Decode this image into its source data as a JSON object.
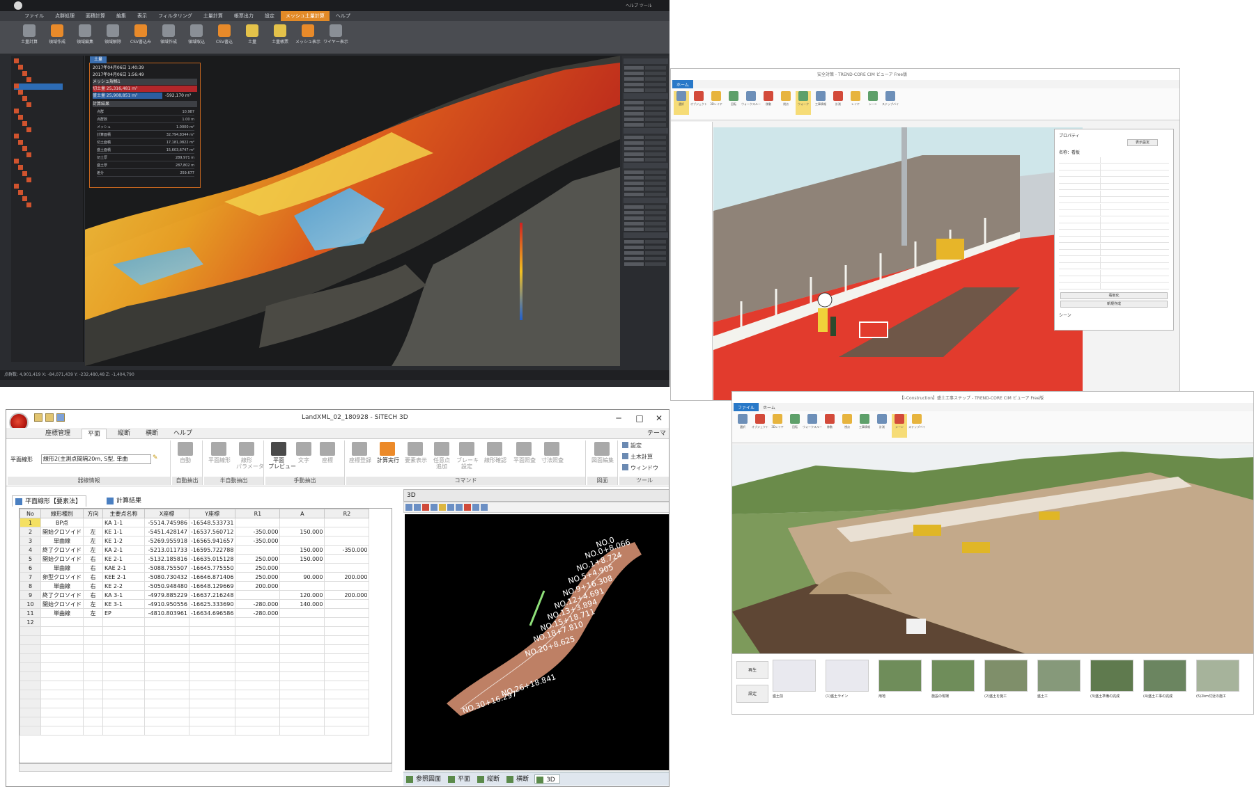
{
  "win_pointcloud": {
    "menus": [
      "ファイル",
      "点群処理",
      "面積計算",
      "編集",
      "表示",
      "フィルタリング",
      "土量計算",
      "帳票出力",
      "設定",
      "メッシュ土量計算",
      "ヘルプ"
    ],
    "active_menu": "メッシュ土量計算",
    "right_title": "ヘルプ ツール",
    "ribbon": [
      {
        "label": "土量計算",
        "icon": "compute-icon"
      },
      {
        "label": "領域作成",
        "icon": "region-icon"
      },
      {
        "label": "領域編集",
        "icon": "edit-region-icon"
      },
      {
        "label": "領域解除",
        "icon": "clear-region-icon"
      },
      {
        "label": "CSV書込み",
        "icon": "csv-icon"
      },
      {
        "label": "領域作成",
        "icon": "region-icon"
      },
      {
        "label": "領域取込",
        "icon": "import-icon"
      },
      {
        "label": "CSV書込",
        "icon": "csv-icon"
      },
      {
        "label": "土量",
        "icon": "volume-icon"
      },
      {
        "label": "土量帳票",
        "icon": "report-icon"
      },
      {
        "label": "メッシュ表示",
        "icon": "mesh-icon"
      },
      {
        "label": "ワイヤー表示",
        "icon": "wire-icon"
      }
    ],
    "info": {
      "tab": "土量",
      "date1": "2017年04月06日 1:40:39",
      "date2": "2017年04月06日 1:56:49",
      "mesh_label": "メッシュ規格1",
      "cut": "切土量 25,316,481 m³",
      "fill": "盛土量 25,908,851 m³",
      "diff": "-592,170 m³",
      "section": "計算結果",
      "rows": [
        [
          "点群",
          "10,987"
        ],
        [
          "点群数",
          "1.00 m"
        ],
        [
          "メッシュ",
          "1.0000 m²"
        ],
        [
          "計算面積",
          "32,794,8344 m²"
        ],
        [
          "切土面積",
          "17,181,0822 m²"
        ],
        [
          "盛土面積",
          "15,603,6747 m²"
        ],
        [
          "切土厚",
          "289,971 m"
        ],
        [
          "盛土厚",
          "287,802 m"
        ],
        [
          "差分",
          "259.677"
        ]
      ]
    },
    "status": "点群数: 4,901,419   X: -84,071,439   Y: -232,480,48   Z: -1,404,790"
  },
  "win_scene": {
    "title": "安全対策 - TREND-CORE CIM ビューア Free版",
    "tabs": [
      "ホーム"
    ],
    "ribbon": [
      {
        "label": "選択",
        "icon": "select-icon",
        "selected": true
      },
      {
        "label": "オブジェクト",
        "icon": "object-icon"
      },
      {
        "label": "3Dレイヤ",
        "icon": "layer-icon"
      },
      {
        "label": "回転",
        "icon": "rotate-icon"
      },
      {
        "label": "ウォークスルー",
        "icon": "walk-icon"
      },
      {
        "label": "移動",
        "icon": "move-icon"
      },
      {
        "label": "視点",
        "icon": "view-icon"
      },
      {
        "label": "ウォーク",
        "icon": "walk2-icon",
        "selected": true
      },
      {
        "label": "工事情報",
        "icon": "info-icon"
      },
      {
        "label": "計測",
        "icon": "measure-icon"
      },
      {
        "label": "レイヤ",
        "icon": "layer2-icon"
      },
      {
        "label": "シーン",
        "icon": "scene-icon"
      },
      {
        "label": "ステップバイ",
        "icon": "step-icon"
      }
    ],
    "props": {
      "title": "プロパティ",
      "button": "表示設定",
      "name_label": "名称",
      "name_value": "看板",
      "btn1": "看板化",
      "btn2": "新規作成",
      "section": "シーン"
    }
  },
  "win_sitech": {
    "title": "LandXML_02_180928 - SiTECH 3D",
    "controls": {
      "minimize": "─",
      "maximize": "□",
      "close": "✕"
    },
    "tabs": [
      "座標管理",
      "平面",
      "縦断",
      "横断",
      "ヘルプ"
    ],
    "active_tab": "平面",
    "theme": "テーマ",
    "ribbon": {
      "line_label": "平面線形",
      "line_value": "線形2(主測点間隔20m, S型, 単曲",
      "groups": [
        {
          "label": "器線情報"
        },
        {
          "label": "自動抽出"
        },
        {
          "label": "半自動抽出"
        },
        {
          "label": "手動抽出"
        },
        {
          "label": "コマンド"
        },
        {
          "label": "図面"
        },
        {
          "label": "ツール"
        }
      ],
      "buttons": [
        {
          "label": "自動",
          "icon": "auto-icon",
          "dim": true
        },
        {
          "label": "平面線形",
          "icon": "plan-line-icon",
          "dim": true
        },
        {
          "label": "線形\nパラメータ",
          "icon": "line-param-icon",
          "dim": true
        },
        {
          "label": "平面\nプレビュー",
          "icon": "plan-preview-icon"
        },
        {
          "label": "文字",
          "icon": "text-icon",
          "dim": true
        },
        {
          "label": "座標",
          "icon": "coord-icon",
          "dim": true
        },
        {
          "label": "座標登録",
          "icon": "coord-register-icon",
          "dim": true
        },
        {
          "label": "計算実行",
          "icon": "calculator-icon"
        },
        {
          "label": "要素表示",
          "icon": "element-icon",
          "dim": true
        },
        {
          "label": "任意点\n追加",
          "icon": "add-point-icon",
          "dim": true
        },
        {
          "label": "ブレーキ\n設定",
          "icon": "break-icon",
          "dim": true
        },
        {
          "label": "線形確認",
          "icon": "check-line-icon",
          "dim": true
        },
        {
          "label": "平面照査",
          "icon": "plan-check-icon",
          "dim": true
        },
        {
          "label": "寸法照査",
          "icon": "dim-check-icon",
          "dim": true
        },
        {
          "label": "図面編集",
          "icon": "drawing-edit-icon",
          "dim": true
        }
      ],
      "side": [
        "設定",
        "土木計算",
        "ウィンドウ"
      ]
    },
    "doc_tabs": [
      "平面線形【要素法】",
      "計算結果"
    ],
    "columns": [
      "No",
      "線形種別",
      "方向",
      "主要点名称",
      "X座標",
      "Y座標",
      "R1",
      "A",
      "R2"
    ],
    "rows": [
      [
        "1",
        "BP点",
        "",
        "KA 1-1",
        "-5514.745986",
        "-16548.533731",
        "",
        "",
        ""
      ],
      [
        "2",
        "開始クロソイド",
        "左",
        "KE 1-1",
        "-5451.428147",
        "-16537.560712",
        "-350.000",
        "150.000",
        ""
      ],
      [
        "3",
        "単曲線",
        "左",
        "KE 1-2",
        "-5269.955918",
        "-16565.941657",
        "-350.000",
        "",
        ""
      ],
      [
        "4",
        "終了クロソイド",
        "左",
        "KA 2-1",
        "-5213.011733",
        "-16595.722788",
        "",
        "150.000",
        "-350.000"
      ],
      [
        "5",
        "開始クロソイド",
        "右",
        "KE 2-1",
        "-5132.185816",
        "-16635.015128",
        "250.000",
        "150.000",
        ""
      ],
      [
        "6",
        "単曲線",
        "右",
        "KAE 2-1",
        "-5088.755507",
        "-16645.775550",
        "250.000",
        "",
        ""
      ],
      [
        "7",
        "卵型クロソイド",
        "右",
        "KEE 2-1",
        "-5080.730432",
        "-16646.871406",
        "250.000",
        "90.000",
        "200.000"
      ],
      [
        "8",
        "単曲線",
        "右",
        "KE 2-2",
        "-5050.948480",
        "-16648.129669",
        "200.000",
        "",
        ""
      ],
      [
        "9",
        "終了クロソイド",
        "右",
        "KA 3-1",
        "-4979.885229",
        "-16637.216248",
        "",
        "120.000",
        "200.000"
      ],
      [
        "10",
        "開始クロソイド",
        "左",
        "KE 3-1",
        "-4910.950556",
        "-16625.333690",
        "-280.000",
        "140.000",
        ""
      ],
      [
        "11",
        "単曲線",
        "左",
        "EP",
        "-4810.803961",
        "-16634.696586",
        "-280.000",
        "",
        ""
      ],
      [
        "12",
        "",
        "",
        "",
        "",
        "",
        "",
        "",
        ""
      ]
    ],
    "pane3d_title": "3D",
    "station_labels": [
      "NO.0",
      "NO.0+8.066",
      "NO.1+8.724",
      "NO.5+4.905",
      "NO.9+16.308",
      "NO.12+4.691",
      "NO.13+3.894",
      "NO.15+18.711",
      "NO.18+7.810",
      "NO.20+8.625",
      "NO.26+18.841",
      "NO.30+16.297"
    ],
    "bottom_tabs": [
      "参照図面",
      "平面",
      "縦断",
      "横断",
      "3D"
    ],
    "active_bottom": "3D"
  },
  "win_trend": {
    "title": "【i-Construction】盛土工事ステップ - TREND-CORE CIM ビューア Free版",
    "tabs": [
      "ファイル",
      "ホーム"
    ],
    "ribbon": [
      {
        "label": "選択",
        "icon": "select-icon"
      },
      {
        "label": "オブジェクト",
        "icon": "object-icon"
      },
      {
        "label": "3Dレイヤ",
        "icon": "layer-icon"
      },
      {
        "label": "回転",
        "icon": "rotate-icon"
      },
      {
        "label": "ウォークスルー",
        "icon": "walk-icon"
      },
      {
        "label": "移動",
        "icon": "move-icon"
      },
      {
        "label": "視点",
        "icon": "view-icon"
      },
      {
        "label": "工事情報",
        "icon": "info-icon"
      },
      {
        "label": "計測",
        "icon": "measure-icon"
      },
      {
        "label": "シーン",
        "icon": "scene-icon",
        "selected": true
      },
      {
        "label": "ステップバイ",
        "icon": "step-icon"
      }
    ],
    "scene_side": [
      "再生",
      "設定"
    ],
    "scenes": [
      "盛土前",
      "(1)盛土ライン",
      "用地",
      "施設の現場",
      "(2)盛土を施工",
      "盛土工",
      "(3)盛土準備の完成",
      "(4)盛土工事の完成",
      "(5)2km付近の施工"
    ]
  },
  "colors": {
    "accent_orange": "#e28a27",
    "ribbon_blue": "#2878c8",
    "selected_row": "#f4e062"
  }
}
